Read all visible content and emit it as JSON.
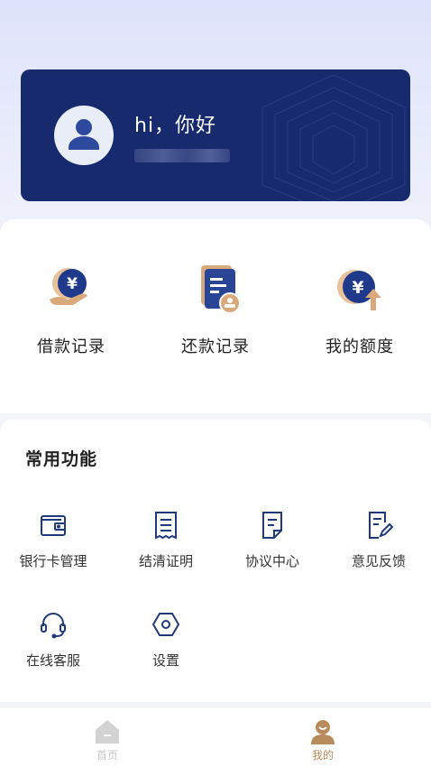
{
  "profile": {
    "greeting": "hi，你好",
    "icon": "user-avatar-icon",
    "masked_phone_visible": false
  },
  "quick_actions": [
    {
      "label": "借款记录",
      "icon": "yuan-hand-icon"
    },
    {
      "label": "还款记录",
      "icon": "document-stamp-icon"
    },
    {
      "label": "我的额度",
      "icon": "yuan-up-arrow-icon"
    }
  ],
  "functions": {
    "title": "常用功能",
    "items": [
      {
        "label": "银行卡管理",
        "icon": "wallet-icon"
      },
      {
        "label": "结清证明",
        "icon": "receipt-icon"
      },
      {
        "label": "协议中心",
        "icon": "agreement-icon"
      },
      {
        "label": "意见反馈",
        "icon": "feedback-edit-icon"
      },
      {
        "label": "在线客服",
        "icon": "headset-icon"
      },
      {
        "label": "设置",
        "icon": "settings-hex-icon"
      }
    ]
  },
  "tabbar": {
    "items": [
      {
        "label": "首页",
        "icon": "home-icon",
        "active": false
      },
      {
        "label": "我的",
        "icon": "profile-icon",
        "active": true
      }
    ]
  },
  "colors": {
    "brand_navy": "#172a6e",
    "accent_tan": "#d9a87b",
    "icon_blue": "#1f3a7a",
    "tab_active": "#b78b5c",
    "tab_inactive": "#c7c7c7"
  }
}
